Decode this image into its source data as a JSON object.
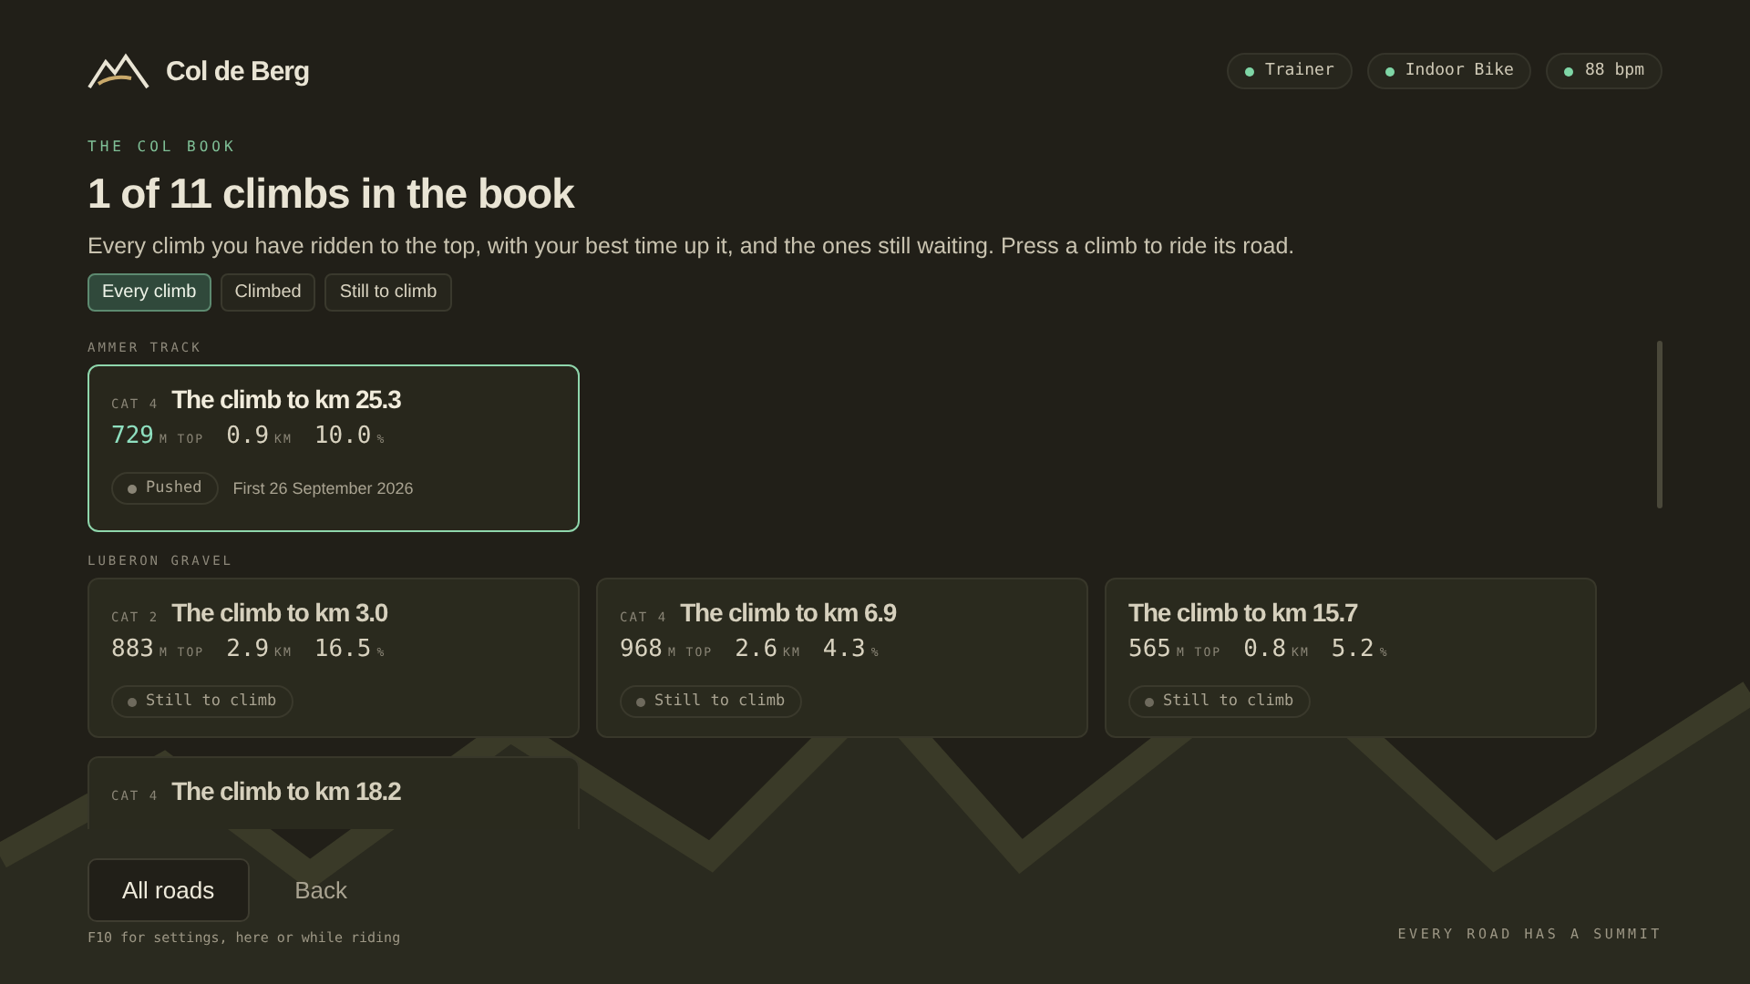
{
  "brand": {
    "name": "Col de Berg"
  },
  "status_chips": [
    {
      "label": "Trainer",
      "color": "#7fd6a6"
    },
    {
      "label": "Indoor Bike",
      "color": "#7fd6a6"
    },
    {
      "label": "88 bpm",
      "color": "#7fd6a6"
    }
  ],
  "eyebrow": "THE COL BOOK",
  "title": "1 of 11 climbs in the book",
  "subtitle": "Every climb you have ridden to the top, with your best time up it, and the ones still waiting. Press a climb to ride its road.",
  "filters": [
    {
      "label": "Every climb",
      "selected": true
    },
    {
      "label": "Climbed",
      "selected": false
    },
    {
      "label": "Still to climb",
      "selected": false
    }
  ],
  "groups": [
    {
      "name": "AMMER TRACK",
      "climbs": [
        {
          "cat": "CAT 4",
          "title": "The climb to km 25.3",
          "selected": true,
          "stats": [
            {
              "value": "729",
              "unit": "M TOP"
            },
            {
              "value": "0.9",
              "unit": "KM"
            },
            {
              "value": "10.0",
              "unit": "%"
            }
          ],
          "status": {
            "label": "Pushed",
            "climbed": true
          },
          "note": "First 26 September 2026"
        }
      ]
    },
    {
      "name": "LUBERON GRAVEL",
      "climbs": [
        {
          "cat": "CAT 2",
          "title": "The climb to km 3.0",
          "selected": false,
          "stats": [
            {
              "value": "883",
              "unit": "M TOP"
            },
            {
              "value": "2.9",
              "unit": "KM"
            },
            {
              "value": "16.5",
              "unit": "%"
            }
          ],
          "status": {
            "label": "Still to climb",
            "climbed": false
          }
        },
        {
          "cat": "CAT 4",
          "title": "The climb to km 6.9",
          "selected": false,
          "stats": [
            {
              "value": "968",
              "unit": "M TOP"
            },
            {
              "value": "2.6",
              "unit": "KM"
            },
            {
              "value": "4.3",
              "unit": "%"
            }
          ],
          "status": {
            "label": "Still to climb",
            "climbed": false
          }
        },
        {
          "title": "The climb to km 15.7",
          "selected": false,
          "stats": [
            {
              "value": "565",
              "unit": "M TOP"
            },
            {
              "value": "0.8",
              "unit": "KM"
            },
            {
              "value": "5.2",
              "unit": "%"
            }
          ],
          "status": {
            "label": "Still to climb",
            "climbed": false
          }
        },
        {
          "cat": "CAT 4",
          "title": "The climb to km 18.2",
          "selected": false
        }
      ]
    }
  ],
  "footer": {
    "buttons": [
      {
        "label": "All roads",
        "selected": true
      },
      {
        "label": "Back",
        "selected": false
      }
    ],
    "hint": "F10 for settings, here or while riding",
    "tagline": "EVERY ROAD HAS A SUMMIT"
  }
}
